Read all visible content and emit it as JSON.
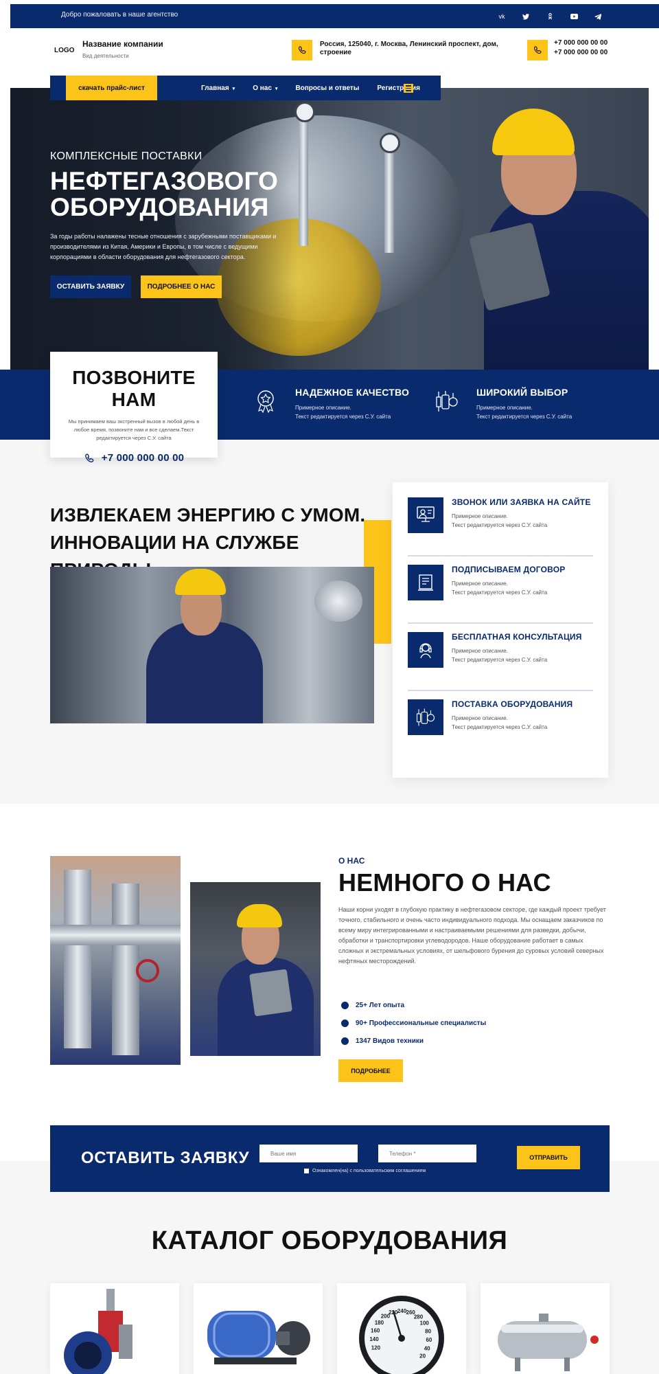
{
  "topbar": {
    "welcome": "Добро пожаловать в наше агентство",
    "social": [
      "vk-icon",
      "twitter-icon",
      "odnoklassniki-icon",
      "youtube-icon",
      "telegram-icon"
    ]
  },
  "header": {
    "logo": "LOGO",
    "company_name": "Название компании",
    "company_sub": "Вид деятельности",
    "address": "Россия, 125040, г. Москва, Ленинский проспект, дом, строение",
    "phone_1": "+7 000 000 00 00",
    "phone_2": "+7 000 000 00 00"
  },
  "nav": {
    "price_button": "скачать прайс-лист",
    "links": [
      "Главная",
      "О нас",
      "Вопросы и ответы",
      "Регистрация"
    ]
  },
  "hero": {
    "kicker": "КОМПЛЕКСНЫЕ ПОСТАВКИ",
    "title": "НЕФТЕГАЗОВОГО ОБОРУДОВАНИЯ",
    "description": "За годы работы налажены тесные отношения с зарубежными поставщиками и производителями из Китая, Америки и Европы, в том числе с ведущими корпорациями в области оборудования для нефтегазового сектора.",
    "btn_apply": "ОСТАВИТЬ ЗАЯВКУ",
    "btn_more": "ПОДРОБНЕЕ О НАС"
  },
  "call": {
    "title": "ПОЗВОНИТЕ НАМ",
    "text": "Мы принимаем ваш экстренный вызов в любой день в любое время, позвоните нам и все сделаем.Текст редактируется через С.У. сайта",
    "phone": "+7 000 000 00 00"
  },
  "features": [
    {
      "title": "НАДЕЖНОЕ КАЧЕСТВО",
      "line1": "Примерное описание.",
      "line2": "Текст редактируется через С.У. сайта"
    },
    {
      "title": "ШИРОКИЙ ВЫБОР",
      "line1": "Примерное описание.",
      "line2": "Текст редактируется через С.У. сайта"
    }
  ],
  "section2": {
    "title_line1": "ИЗВЛЕКАЕМ ЭНЕРГИЮ С УМОМ.",
    "title_line2": "ИННОВАЦИИ НА СЛУЖБЕ ПРИРОДЫ",
    "steps": [
      {
        "title": "ЗВОНОК ИЛИ ЗАЯВКА НА САЙТЕ",
        "line1": "Примерное описание.",
        "line2": "Текст редактируется через С.У. сайта"
      },
      {
        "title": "ПОДПИСЫВАЕМ ДОГОВОР",
        "line1": "Примерное описание.",
        "line2": "Текст редактируется через С.У. сайта"
      },
      {
        "title": "БЕСПЛАТНАЯ КОНСУЛЬТАЦИЯ",
        "line1": "Примерное описание.",
        "line2": "Текст редактируется через С.У. сайта"
      },
      {
        "title": "ПОСТАВКА ОБОРУДОВАНИЯ",
        "line1": "Примерное описание.",
        "line2": "Текст редактируется через С.У. сайта"
      }
    ]
  },
  "about": {
    "kicker": "О НАС",
    "title": "НЕМНОГО О НАС",
    "description": "Наши корни уходят в глубокую практику в нефтегазовом секторе, где каждый проект требует точного, стабильного и очень часто индивидуального подхода. Мы оснащаем заказчиков по всему миру интегрированными и настраиваемыми решениями для разведки, добычи, обработки и транспортировки углеводородов. Наше оборудование работает в самых сложных и экстремальных условиях, от шельфового бурения до суровых условий северных нефтяных месторождений.",
    "list": [
      "25+ Лет опыта",
      "90+ Профессиональные специалисты",
      "1347 Видов техники"
    ],
    "button": "ПОДРОБНЕЕ"
  },
  "request": {
    "title": "ОСТАВИТЬ  ЗАЯВКУ",
    "name_placeholder": "Ваше имя",
    "phone_placeholder": "Телефон *",
    "consent": "Ознакомлен(на) с пользовательским соглашением",
    "send": "ОТПРАВИТЬ"
  },
  "catalog": {
    "title": "КАТАЛОГ ОБОРУДОВАНИЯ",
    "gauge_labels": [
      "120",
      "140",
      "160",
      "180",
      "200",
      "220",
      "240",
      "260",
      "280",
      "100",
      "80",
      "60",
      "40",
      "20"
    ]
  },
  "colors": {
    "navy": "#0a2a6e",
    "yellow": "#fcc419"
  }
}
